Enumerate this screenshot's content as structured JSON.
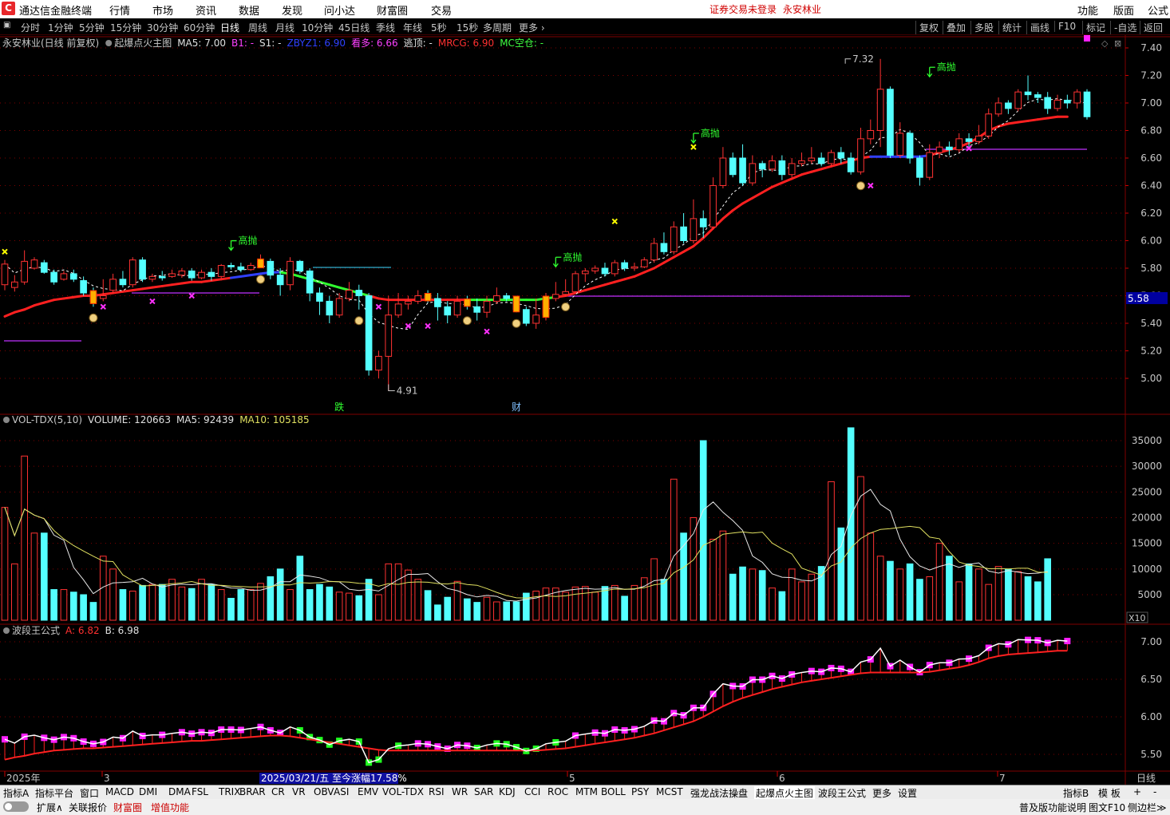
{
  "menubar": {
    "app_title": "通达信金融终端",
    "items": [
      "行情",
      "市场",
      "资讯",
      "数据",
      "发现",
      "问小达",
      "财富圈",
      "交易"
    ],
    "login_notice": "证券交易未登录",
    "stock_title": "永安林业",
    "right_items": [
      "功能",
      "版面",
      "公式"
    ]
  },
  "periods": {
    "items": [
      "分时",
      "1分钟",
      "5分钟",
      "15分钟",
      "30分钟",
      "60分钟",
      "日线",
      "周线",
      "月线",
      "10分钟",
      "45日线",
      "季线",
      "年线",
      "5秒",
      "15秒",
      "多周期",
      "更多"
    ],
    "active": "日线",
    "tools": [
      "复权",
      "叠加",
      "多股",
      "统计",
      "画线",
      "F10",
      "标记",
      "-自选",
      "返回"
    ]
  },
  "main_panel": {
    "legend": [
      {
        "text": "永安林业(日线 前复权)",
        "color": "#c8c8c8"
      },
      {
        "text": "起爆点火主图",
        "color": "#c8c8c8"
      },
      {
        "text": "MA5: 7.00",
        "color": "#e0e0e0"
      },
      {
        "text": "B1: -",
        "color": "#ff40ff"
      },
      {
        "text": "S1: -",
        "color": "#e0e0e0"
      },
      {
        "text": "ZBYZ1: 6.90",
        "color": "#3040ff"
      },
      {
        "text": "看多: 6.66",
        "color": "#ff40ff"
      },
      {
        "text": "逃顶: -",
        "color": "#e0e0e0"
      },
      {
        "text": "MRCG: 6.90",
        "color": "#ff3030"
      },
      {
        "text": "MC空仓: -",
        "color": "#40ff40"
      }
    ],
    "y_ticks": [
      "7.40",
      "7.20",
      "7.00",
      "6.80",
      "6.60",
      "6.40",
      "6.20",
      "6.00",
      "5.80",
      "5.60",
      "5.40",
      "5.20",
      "5.00"
    ],
    "y_values": [
      7.4,
      7.2,
      7.0,
      6.8,
      6.6,
      6.4,
      6.2,
      6.0,
      5.8,
      5.6,
      5.4,
      5.2,
      5.0
    ],
    "current_price_tag": "5.58",
    "high_label": "7.32",
    "low_label": "4.91",
    "signal_labels": [
      "高抛",
      "高抛",
      "高抛",
      "高抛"
    ],
    "event_labels": [
      "跌",
      "财"
    ]
  },
  "volume_panel": {
    "legend": [
      {
        "text": "VOL-TDX(5,10)",
        "color": "#c8c8c8"
      },
      {
        "text": "VOLUME: 120663",
        "color": "#e0e0e0"
      },
      {
        "text": "MA5: 92439",
        "color": "#e0e0e0"
      },
      {
        "text": "MA10: 105185",
        "color": "#e0e060"
      }
    ],
    "y_ticks": [
      "35000",
      "30000",
      "25000",
      "20000",
      "15000",
      "10000",
      "5000"
    ],
    "y_values": [
      35000,
      30000,
      25000,
      20000,
      15000,
      10000,
      5000
    ],
    "unit": "X10"
  },
  "wave_panel": {
    "legend": [
      {
        "text": "波段王公式",
        "color": "#c8c8c8"
      },
      {
        "text": "A: 6.82",
        "color": "#ff3030"
      },
      {
        "text": "B: 6.98",
        "color": "#e0e0e0"
      }
    ],
    "y_ticks": [
      "7.00",
      "6.50",
      "6.00",
      "5.50"
    ],
    "y_values": [
      7.0,
      6.5,
      6.0,
      5.5
    ]
  },
  "time_axis": {
    "labels": [
      "2025年",
      "3",
      "5",
      "6",
      "7"
    ],
    "highlight": "2025/03/21/五  至今涨幅17.58%",
    "period": "日线"
  },
  "bottom_tabs": {
    "items": [
      "指标A",
      "指标平台",
      "窗口",
      "MACD",
      "DMI",
      "DMA",
      "FSL",
      "TRIX",
      "BRAR",
      "CR",
      "VR",
      "OBV",
      "ASI",
      "EMV",
      "VOL-TDX",
      "RSI",
      "WR",
      "SAR",
      "KDJ",
      "CCI",
      "ROC",
      "MTM",
      "BOLL",
      "PSY",
      "MCST",
      "强龙战法操盘",
      "起爆点火主图",
      "波段王公式",
      "更多",
      "设置"
    ],
    "active": "起爆点火主图",
    "right_items": [
      "指标B",
      "模 板",
      "+",
      "-"
    ]
  },
  "statusbar": {
    "items": [
      "扩展∧",
      "关联报价",
      "财富圈",
      "增值功能"
    ],
    "right_items": [
      "普及版功能说明",
      "图文F10",
      "侧边栏≫"
    ]
  },
  "colors": {
    "up": "#ff3232",
    "down": "#54ffff",
    "ma_red": "#ff2020",
    "ma_green": "#30ff30",
    "purple": "#c030ff",
    "grid": "#800000"
  },
  "chart_data": {
    "type": "candlestick",
    "title": "永安林业(日线 前复权)",
    "dates_visible": [
      "2025-02",
      "2025-03",
      "2025-05",
      "2025-06",
      "2025-07"
    ],
    "ylim": [
      4.9,
      7.45
    ],
    "candles": [
      [
        5.68,
        5.83,
        5.86,
        5.64
      ],
      [
        5.66,
        5.7,
        5.75,
        5.63
      ],
      [
        5.7,
        5.85,
        5.93,
        5.68
      ],
      [
        5.8,
        5.86,
        5.88,
        5.79
      ],
      [
        5.84,
        5.77,
        5.86,
        5.76
      ],
      [
        5.77,
        5.7,
        5.79,
        5.68
      ],
      [
        5.72,
        5.76,
        5.78,
        5.71
      ],
      [
        5.76,
        5.72,
        5.79,
        5.7
      ],
      [
        5.71,
        5.62,
        5.74,
        5.6
      ],
      [
        5.62,
        5.56,
        5.66,
        5.52
      ],
      [
        5.58,
        5.6,
        5.72,
        5.56
      ],
      [
        5.64,
        5.72,
        5.76,
        5.62
      ],
      [
        5.72,
        5.68,
        5.78,
        5.66
      ],
      [
        5.68,
        5.86,
        5.88,
        5.66
      ],
      [
        5.86,
        5.72,
        5.88,
        5.7
      ],
      [
        5.72,
        5.74,
        5.76,
        5.7
      ],
      [
        5.74,
        5.73,
        5.78,
        5.71
      ],
      [
        5.74,
        5.76,
        5.79,
        5.73
      ],
      [
        5.75,
        5.78,
        5.8,
        5.73
      ],
      [
        5.78,
        5.73,
        5.8,
        5.71
      ],
      [
        5.73,
        5.77,
        5.79,
        5.72
      ],
      [
        5.77,
        5.74,
        5.8,
        5.71
      ],
      [
        5.74,
        5.82,
        5.83,
        5.72
      ],
      [
        5.82,
        5.81,
        5.84,
        5.79
      ],
      [
        5.81,
        5.79,
        5.84,
        5.77
      ],
      [
        5.79,
        5.82,
        5.84,
        5.78
      ],
      [
        5.82,
        5.85,
        5.9,
        5.8
      ],
      [
        5.85,
        5.75,
        5.87,
        5.72
      ],
      [
        5.75,
        5.68,
        5.8,
        5.6
      ],
      [
        5.68,
        5.85,
        5.88,
        5.64
      ],
      [
        5.85,
        5.78,
        5.86,
        5.76
      ],
      [
        5.78,
        5.62,
        5.8,
        5.56
      ],
      [
        5.62,
        5.56,
        5.66,
        5.46
      ],
      [
        5.56,
        5.46,
        5.6,
        5.4
      ],
      [
        5.46,
        5.58,
        5.62,
        5.44
      ],
      [
        5.58,
        5.64,
        5.7,
        5.56
      ],
      [
        5.64,
        5.6,
        5.68,
        5.5
      ],
      [
        5.6,
        5.06,
        5.62,
        5.02
      ],
      [
        5.06,
        5.16,
        5.2,
        5.0
      ],
      [
        5.16,
        5.46,
        5.6,
        4.91
      ],
      [
        5.46,
        5.54,
        5.62,
        5.44
      ],
      [
        5.54,
        5.56,
        5.6,
        5.5
      ],
      [
        5.56,
        5.6,
        5.64,
        5.54
      ],
      [
        5.6,
        5.58,
        5.64,
        5.55
      ],
      [
        5.58,
        5.52,
        5.62,
        5.42
      ],
      [
        5.52,
        5.46,
        5.56,
        5.4
      ],
      [
        5.46,
        5.56,
        5.6,
        5.44
      ],
      [
        5.56,
        5.54,
        5.6,
        5.5
      ],
      [
        5.52,
        5.48,
        5.58,
        5.42
      ],
      [
        5.48,
        5.56,
        5.6,
        5.44
      ],
      [
        5.56,
        5.6,
        5.66,
        5.54
      ],
      [
        5.6,
        5.58,
        5.62,
        5.56
      ],
      [
        5.58,
        5.5,
        5.6,
        5.48
      ],
      [
        5.5,
        5.4,
        5.52,
        5.38
      ],
      [
        5.4,
        5.46,
        5.58,
        5.36
      ],
      [
        5.46,
        5.58,
        5.62,
        5.42
      ],
      [
        5.58,
        5.61,
        5.7,
        5.56
      ],
      [
        5.61,
        5.63,
        5.72,
        5.6
      ],
      [
        5.63,
        5.76,
        5.78,
        5.62
      ],
      [
        5.76,
        5.78,
        5.8,
        5.7
      ],
      [
        5.78,
        5.8,
        5.82,
        5.76
      ],
      [
        5.8,
        5.76,
        5.84,
        5.74
      ],
      [
        5.76,
        5.84,
        5.86,
        5.74
      ],
      [
        5.84,
        5.8,
        5.86,
        5.78
      ],
      [
        5.8,
        5.81,
        5.84,
        5.78
      ],
      [
        5.81,
        5.86,
        5.88,
        5.8
      ],
      [
        5.86,
        5.98,
        6.02,
        5.84
      ],
      [
        5.98,
        5.92,
        6.06,
        5.9
      ],
      [
        5.92,
        6.1,
        6.14,
        5.9
      ],
      [
        6.1,
        6.0,
        6.2,
        5.98
      ],
      [
        6.0,
        6.16,
        6.3,
        5.98
      ],
      [
        6.16,
        6.1,
        6.22,
        6.02
      ],
      [
        6.1,
        6.4,
        6.46,
        6.08
      ],
      [
        6.4,
        6.6,
        6.68,
        6.38
      ],
      [
        6.6,
        6.48,
        6.64,
        6.46
      ],
      [
        6.6,
        6.42,
        6.7,
        6.4
      ],
      [
        6.42,
        6.56,
        6.62,
        6.4
      ],
      [
        6.56,
        6.52,
        6.58,
        6.46
      ],
      [
        6.52,
        6.58,
        6.62,
        6.5
      ],
      [
        6.58,
        6.48,
        6.62,
        6.44
      ],
      [
        6.48,
        6.56,
        6.6,
        6.46
      ],
      [
        6.56,
        6.58,
        6.64,
        6.54
      ],
      [
        6.58,
        6.6,
        6.68,
        6.56
      ],
      [
        6.6,
        6.56,
        6.64,
        6.54
      ],
      [
        6.56,
        6.64,
        6.66,
        6.54
      ],
      [
        6.64,
        6.6,
        6.68,
        6.56
      ],
      [
        6.6,
        6.5,
        6.64,
        6.48
      ],
      [
        6.5,
        6.74,
        6.82,
        6.48
      ],
      [
        6.74,
        6.8,
        6.88,
        6.7
      ],
      [
        6.8,
        7.1,
        7.32,
        6.68
      ],
      [
        7.1,
        6.62,
        7.12,
        6.6
      ],
      [
        6.62,
        6.78,
        6.86,
        6.6
      ],
      [
        6.78,
        6.6,
        6.8,
        6.56
      ],
      [
        6.6,
        6.46,
        6.62,
        6.4
      ],
      [
        6.46,
        6.64,
        6.7,
        6.44
      ],
      [
        6.64,
        6.68,
        6.72,
        6.6
      ],
      [
        6.68,
        6.66,
        6.72,
        6.62
      ],
      [
        6.66,
        6.74,
        6.78,
        6.64
      ],
      [
        6.74,
        6.72,
        6.78,
        6.68
      ],
      [
        6.72,
        6.76,
        6.84,
        6.7
      ],
      [
        6.76,
        6.92,
        6.96,
        6.74
      ],
      [
        6.92,
        7.0,
        7.04,
        6.9
      ],
      [
        7.0,
        6.96,
        7.02,
        6.92
      ],
      [
        6.96,
        7.08,
        7.1,
        6.94
      ],
      [
        7.08,
        7.06,
        7.2,
        7.02
      ],
      [
        7.06,
        7.04,
        7.08,
        7.0
      ],
      [
        7.04,
        6.96,
        7.08,
        6.92
      ],
      [
        6.96,
        7.02,
        7.06,
        6.94
      ],
      [
        7.02,
        7.0,
        7.06,
        6.96
      ],
      [
        7.0,
        7.08,
        7.1,
        6.96
      ],
      [
        7.08,
        6.9,
        7.1,
        6.88
      ]
    ],
    "volume": [
      22000,
      11000,
      32000,
      17000,
      17000,
      6000,
      6000,
      5500,
      5000,
      3500,
      12500,
      10000,
      6000,
      5700,
      6800,
      7000,
      7000,
      8000,
      6500,
      6200,
      8000,
      7000,
      6000,
      4300,
      6000,
      6000,
      7200,
      8500,
      10000,
      6000,
      12500,
      6000,
      7000,
      6500,
      5500,
      5300,
      4800,
      8000,
      5000,
      11000,
      11000,
      9800,
      8000,
      5800,
      3000,
      4500,
      7600,
      4200,
      3500,
      4500,
      3600,
      3600,
      3600,
      5300,
      5700,
      6300,
      6300,
      5500,
      6500,
      6600,
      5500,
      6600,
      6800,
      4700,
      6800,
      8300,
      12000,
      8000,
      27500,
      17000,
      20000,
      35000,
      15800,
      17400,
      9000,
      10400,
      10000,
      9700,
      6300,
      5600,
      10000,
      7500,
      9000,
      10500,
      27000,
      18000,
      37500,
      28000,
      17000,
      12500,
      11500,
      10000,
      11000,
      8000,
      8500,
      15000,
      12500,
      7500,
      11000,
      10000,
      7000,
      10500,
      10000,
      9500,
      8500,
      7500,
      12000
    ],
    "ma_line": [
      5.45,
      5.48,
      5.5,
      5.53,
      5.55,
      5.57,
      5.58,
      5.59,
      5.6,
      5.6,
      5.61,
      5.62,
      5.63,
      5.64,
      5.65,
      5.66,
      5.67,
      5.68,
      5.69,
      5.7,
      5.7,
      5.71,
      5.72,
      5.73,
      5.74,
      5.75,
      5.76,
      5.77,
      5.77,
      5.76,
      5.74,
      5.72,
      5.7,
      5.68,
      5.66,
      5.64,
      5.62,
      5.6,
      5.58,
      5.57,
      5.57,
      5.57,
      5.57,
      5.57,
      5.57,
      5.57,
      5.57,
      5.57,
      5.57,
      5.57,
      5.57,
      5.57,
      5.57,
      5.57,
      5.57,
      5.58,
      5.59,
      5.6,
      5.62,
      5.64,
      5.66,
      5.68,
      5.7,
      5.72,
      5.74,
      5.77,
      5.8,
      5.84,
      5.88,
      5.92,
      5.96,
      6.02,
      6.09,
      6.16,
      6.22,
      6.27,
      6.31,
      6.35,
      6.39,
      6.42,
      6.45,
      6.48,
      6.5,
      6.52,
      6.54,
      6.56,
      6.58,
      6.6,
      6.61,
      6.61,
      6.61,
      6.61,
      6.61,
      6.61,
      6.62,
      6.64,
      6.66,
      6.68,
      6.71,
      6.75,
      6.8,
      6.83,
      6.85,
      6.86,
      6.87,
      6.88,
      6.89,
      6.9,
      6.9
    ]
  }
}
